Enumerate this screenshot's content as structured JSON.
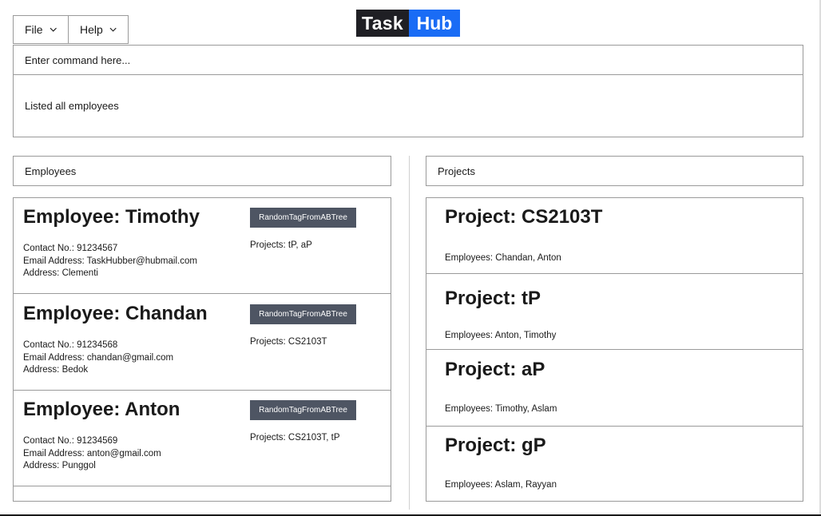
{
  "menu": {
    "file_label": "File",
    "help_label": "Help"
  },
  "logo": {
    "part1": "Task",
    "part2": "Hub"
  },
  "command": {
    "placeholder": "Enter command here..."
  },
  "result": {
    "text": "Listed all employees"
  },
  "employees_panel": {
    "header": "Employees",
    "items": [
      {
        "name": "Employee: Timothy",
        "tag": "RandomTagFromABTree",
        "contact": "Contact No.: 91234567",
        "email": "Email Address: TaskHubber@hubmail.com",
        "address": "Address: Clementi",
        "projects": "Projects: tP, aP"
      },
      {
        "name": "Employee: Chandan",
        "tag": "RandomTagFromABTree",
        "contact": "Contact No.: 91234568",
        "email": "Email Address: chandan@gmail.com",
        "address": "Address: Bedok",
        "projects": "Projects: CS2103T"
      },
      {
        "name": "Employee: Anton",
        "tag": "RandomTagFromABTree",
        "contact": "Contact No.: 91234569",
        "email": "Email Address: anton@gmail.com",
        "address": "Address: Punggol",
        "projects": "Projects: CS2103T, tP"
      }
    ]
  },
  "projects_panel": {
    "header": "Projects",
    "items": [
      {
        "name": "Project: CS2103T",
        "employees": "Employees: Chandan, Anton"
      },
      {
        "name": "Project: tP",
        "employees": "Employees: Anton, Timothy"
      },
      {
        "name": "Project: aP",
        "employees": "Employees: Timothy, Aslam"
      },
      {
        "name": "Project: gP",
        "employees": "Employees: Aslam, Rayyan"
      }
    ]
  },
  "colors": {
    "logo_dark": "#1f1f24",
    "logo_accent": "#1a6cf5",
    "tag_bg": "#4e5563"
  }
}
